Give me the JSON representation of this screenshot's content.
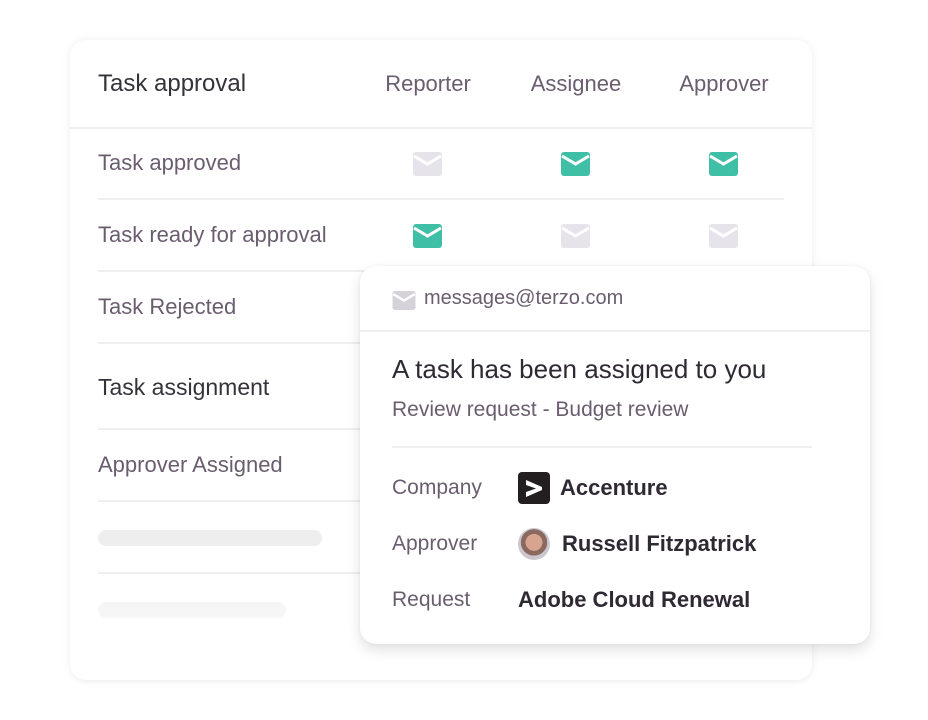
{
  "notification_table": {
    "section_approval": {
      "title": "Task approval",
      "columns": [
        "Reporter",
        "Assignee",
        "Approver"
      ],
      "rows": [
        {
          "label": "Task approved",
          "reporter": false,
          "assignee": true,
          "approver": true
        },
        {
          "label": "Task ready for approval",
          "reporter": true,
          "assignee": false,
          "approver": false
        },
        {
          "label": "Task Rejected"
        }
      ]
    },
    "section_assignment": {
      "title": "Task assignment",
      "rows": [
        {
          "label": "Approver Assigned"
        }
      ]
    },
    "colors": {
      "enabled": "#40bfa7",
      "disabled": "#e6e4ea"
    }
  },
  "email_preview": {
    "sender": "messages@terzo.com",
    "subject": "A task has been assigned to you",
    "subtitle": "Review request - Budget review",
    "fields": [
      {
        "label": "Company",
        "value": "Accenture",
        "icon": "accenture-logo"
      },
      {
        "label": "Approver",
        "value": "Russell Fitzpatrick",
        "icon": "avatar"
      },
      {
        "label": "Request",
        "value": "Adobe Cloud Renewal"
      }
    ]
  }
}
